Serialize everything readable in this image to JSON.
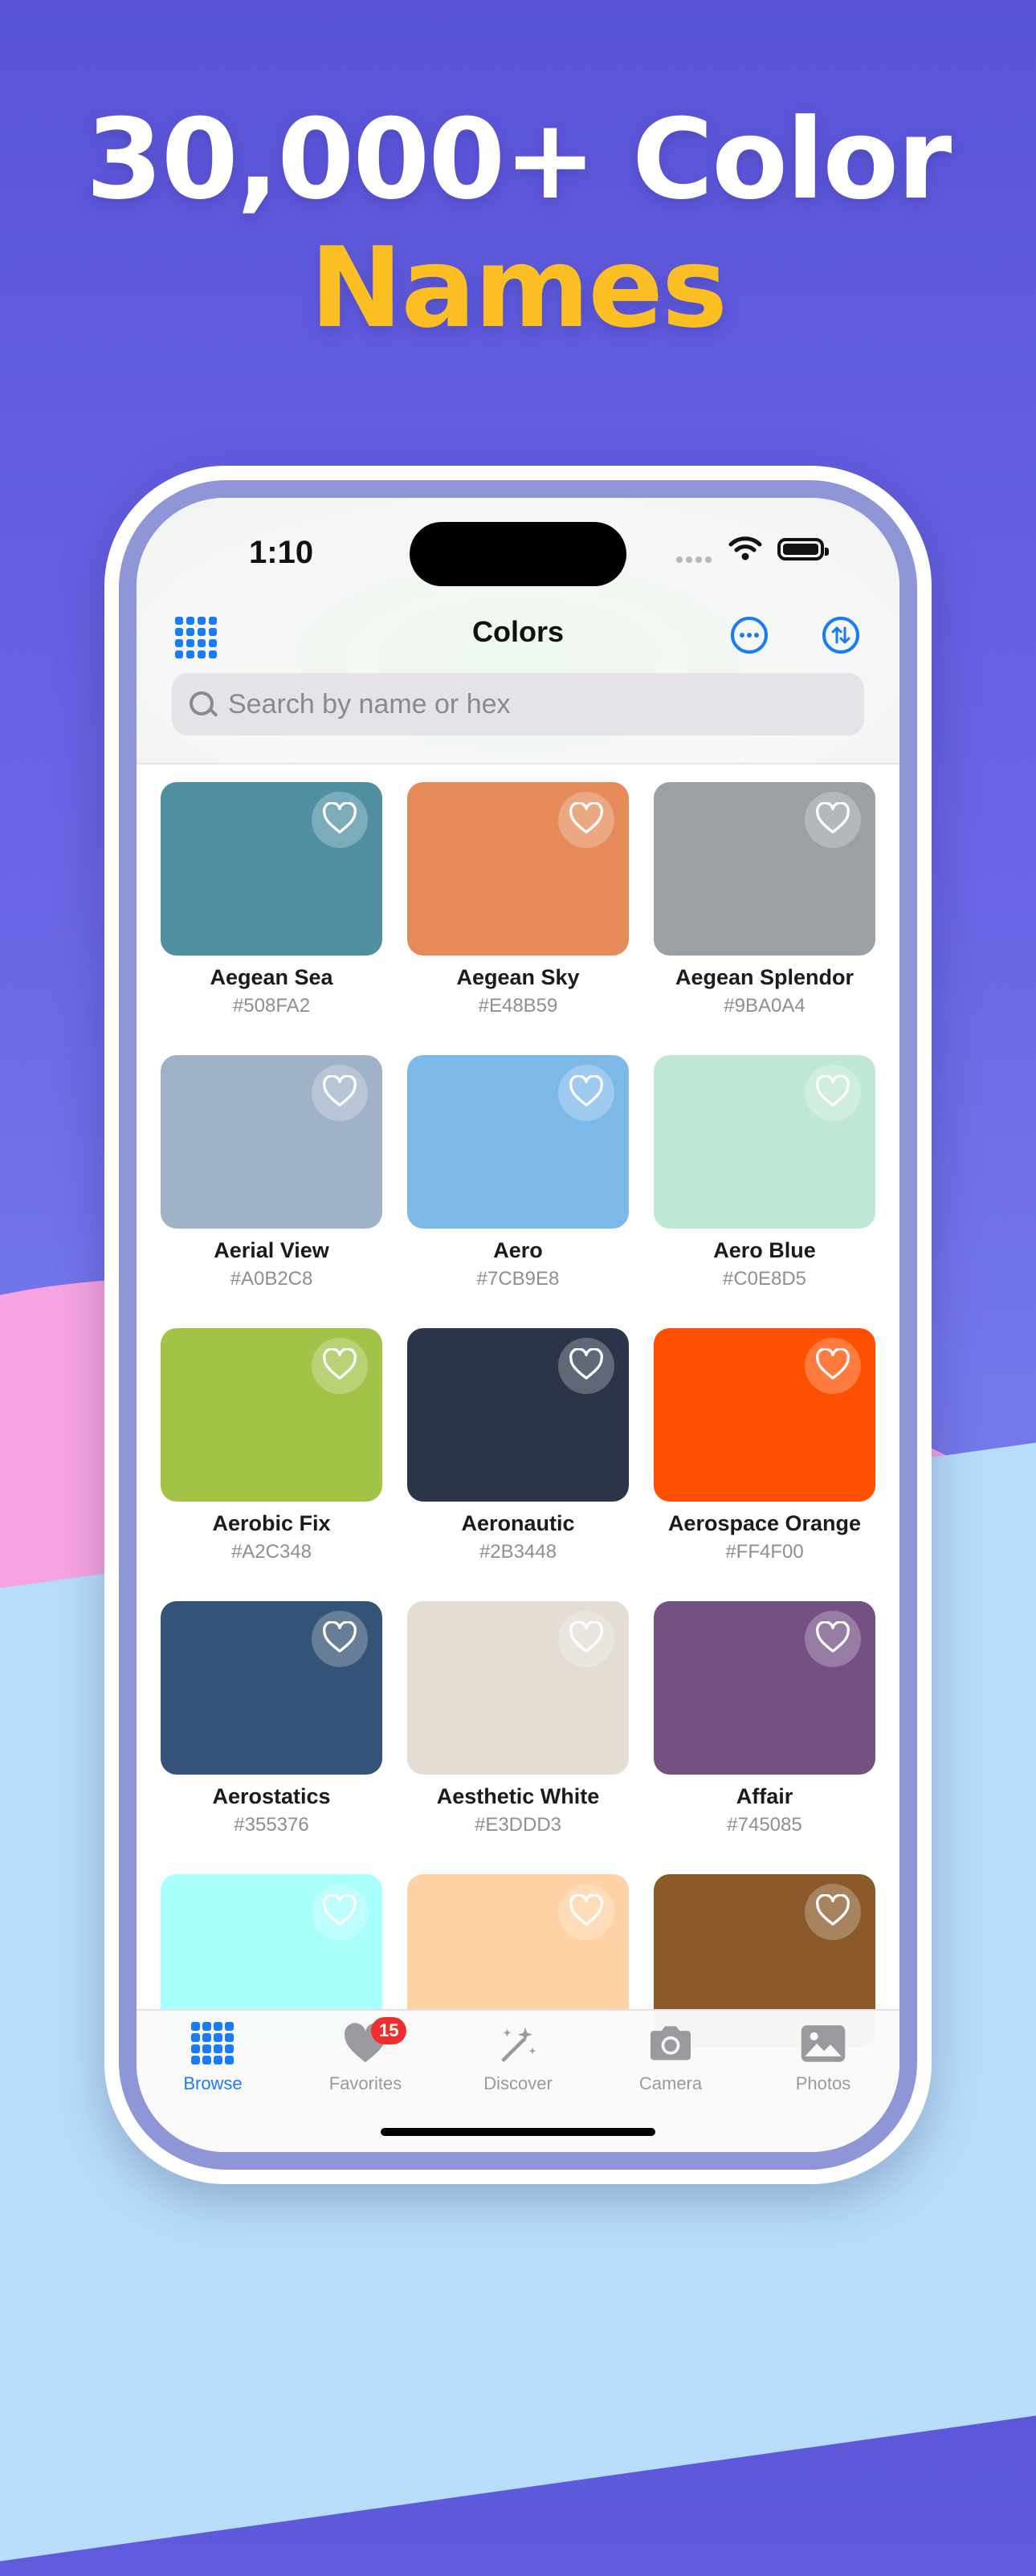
{
  "headline": {
    "line1": "30,000+ Color",
    "line2": "Names"
  },
  "status_bar": {
    "time": "1:10"
  },
  "nav": {
    "title": "Colors"
  },
  "search": {
    "placeholder": "Search by name or hex"
  },
  "colors": [
    {
      "name": "Aegean Sea",
      "hex": "#508FA2",
      "swatch": "#508FA2"
    },
    {
      "name": "Aegean Sky",
      "hex": "#E48B59",
      "swatch": "#E48B59"
    },
    {
      "name": "Aegean Splendor",
      "hex": "#9BA0A4",
      "swatch": "#9BA0A4"
    },
    {
      "name": "Aerial View",
      "hex": "#A0B2C8",
      "swatch": "#A0B2C8"
    },
    {
      "name": "Aero",
      "hex": "#7CB9E8",
      "swatch": "#7CB9E8"
    },
    {
      "name": "Aero Blue",
      "hex": "#C0E8D5",
      "swatch": "#C0E8D5"
    },
    {
      "name": "Aerobic Fix",
      "hex": "#A2C348",
      "swatch": "#A2C348"
    },
    {
      "name": "Aeronautic",
      "hex": "#2B3448",
      "swatch": "#2B3448"
    },
    {
      "name": "Aerospace Orange",
      "hex": "#FF4F00",
      "swatch": "#FF4F00"
    },
    {
      "name": "Aerostatics",
      "hex": "#355376",
      "swatch": "#355376"
    },
    {
      "name": "Aesthetic White",
      "hex": "#E3DDD3",
      "swatch": "#E3DDD3"
    },
    {
      "name": "Affair",
      "hex": "#745085",
      "swatch": "#745085"
    },
    {
      "name": "",
      "hex": "",
      "swatch": "#A8FFFC"
    },
    {
      "name": "",
      "hex": "",
      "swatch": "#FFD2A5"
    },
    {
      "name": "",
      "hex": "",
      "swatch": "#8B5A2B"
    }
  ],
  "tabs": [
    {
      "label": "Browse",
      "icon": "grid-icon",
      "active": true
    },
    {
      "label": "Favorites",
      "icon": "heart-icon",
      "badge": "15"
    },
    {
      "label": "Discover",
      "icon": "magic-wand-icon"
    },
    {
      "label": "Camera",
      "icon": "camera-icon"
    },
    {
      "label": "Photos",
      "icon": "photo-icon"
    }
  ],
  "accent_color": "#1A7CF5",
  "headline_accent_color": "#FBBF24"
}
